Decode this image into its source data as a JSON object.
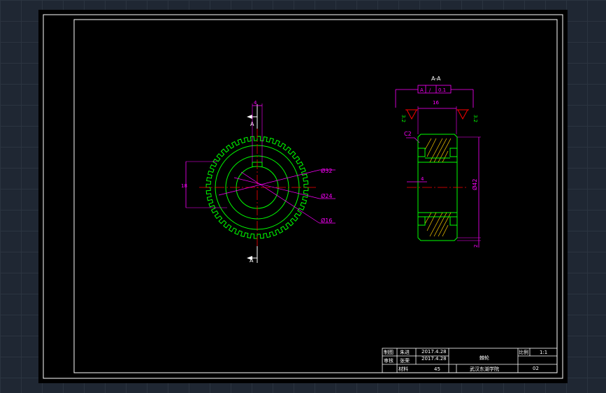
{
  "drawing": {
    "front_view": {
      "section_label_top": "A",
      "section_label_bottom": "A",
      "dim_width": "4",
      "dim_height": "18",
      "dia_outer": "Ø32",
      "dia_middle": "Ø24",
      "dia_inner": "Ø16"
    },
    "section_view": {
      "title": "A-A",
      "tolerance_datum": "A",
      "tolerance_symbol": "∕",
      "tolerance_value": "0.1",
      "dim_width": "16",
      "roughness_left": "3.2",
      "roughness_right": "3.2",
      "chamfer": "C2",
      "dim_keyway": "4",
      "dia_outer": "Ø42",
      "dim_small": "2"
    },
    "title_block": {
      "row1_label": "制图",
      "row1_name": "朱进",
      "row1_date": "2017.4.28",
      "row2_label": "审核",
      "row2_name": "张荣",
      "row2_date": "2017.4.28",
      "material_label": "材料",
      "material_value": "45",
      "part_name": "棘轮",
      "scale_label": "比例",
      "scale_value": "1:1",
      "school": "武汉东湖学院",
      "drawing_number": "02"
    }
  },
  "colors": {
    "background": "#000000",
    "outline_green": "#00ff00",
    "dimension_magenta": "#ff00ff",
    "centerline_red": "#ff0000",
    "hatch_yellow": "#ffd000",
    "frame_white": "#ffffff"
  }
}
